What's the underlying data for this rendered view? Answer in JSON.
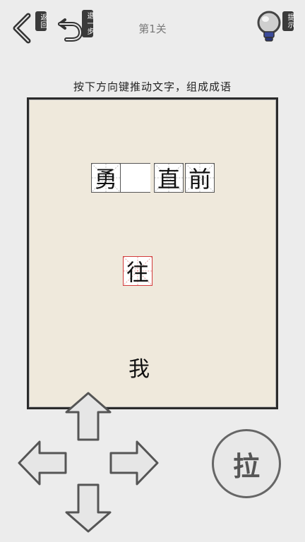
{
  "header": {
    "back_label": "返回",
    "undo_label": "退一步",
    "level_title": "第1关",
    "hint_label": "提示"
  },
  "instruction": "按下方向键推动文字，组成成语",
  "board": {
    "tiles": [
      {
        "char": "勇",
        "style": "normal"
      },
      {
        "char": "",
        "style": "empty"
      },
      {
        "char": "直",
        "style": "normal"
      },
      {
        "char": "前",
        "style": "normal"
      },
      {
        "char": "往",
        "style": "red"
      }
    ],
    "player_char": "我"
  },
  "controls": {
    "pull_label": "拉",
    "icons": [
      "arrow-up-icon",
      "arrow-left-icon",
      "arrow-right-icon",
      "arrow-down-icon"
    ]
  }
}
